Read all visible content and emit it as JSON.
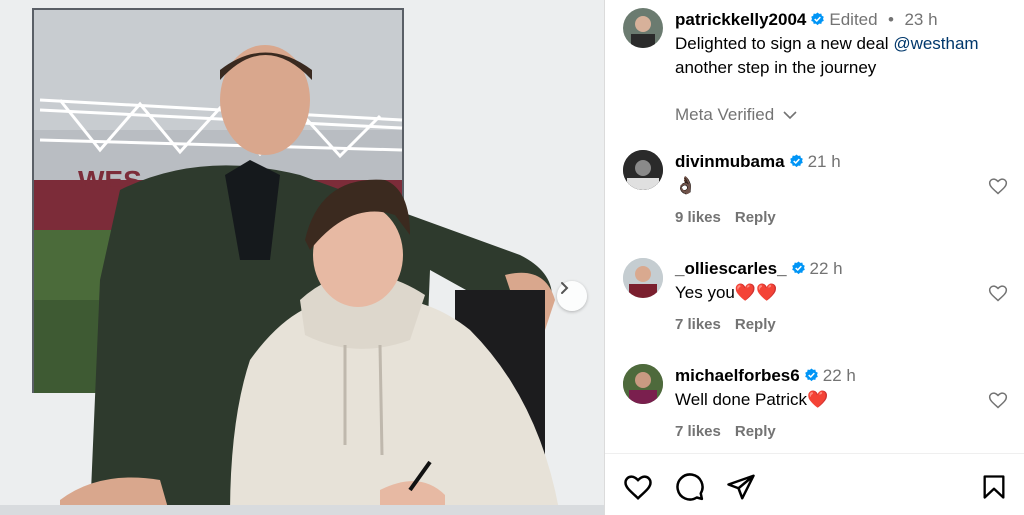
{
  "post": {
    "author": "patrickkelly2004",
    "edited": "Edited",
    "dot": "•",
    "time": "23 h",
    "caption_pre": "Delighted to sign a new deal ",
    "caption_mention": "@westham",
    "caption_line2": "another step in the journey",
    "meta_verified": "Meta Verified",
    "sign_text": "WES"
  },
  "comments": [
    {
      "user": "divinmubama",
      "time": "21 h",
      "text": "👌🏿",
      "likes": "9 likes",
      "reply": "Reply"
    },
    {
      "user": "_olliescarles_",
      "time": "22 h",
      "text": "Yes you❤️❤️",
      "likes": "7 likes",
      "reply": "Reply"
    },
    {
      "user": "michaelforbes6",
      "time": "22 h",
      "text": "Well done Patrick❤️",
      "likes": "7 likes",
      "reply": "Reply"
    }
  ],
  "icons": {
    "like": "heart-icon",
    "comment": "comment-icon",
    "share": "send-icon",
    "save": "bookmark-icon",
    "verified": "verified-badge-icon",
    "next": "chevron-right-icon"
  },
  "colors": {
    "verified": "#0095f6",
    "link": "#00376b",
    "muted": "#737373"
  }
}
